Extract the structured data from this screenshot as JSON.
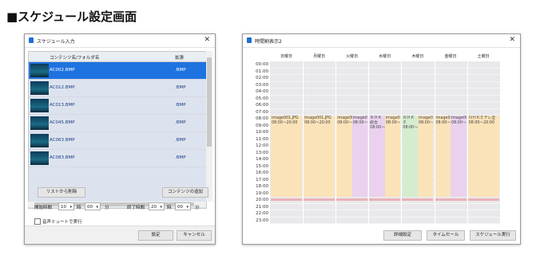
{
  "page": {
    "heading": "■スケジュール設定画面"
  },
  "input_window": {
    "title": "スケジュール入力",
    "columns": [
      "コンテンツ名/フォルダ名",
      "拡張"
    ],
    "rows": [
      {
        "name": "AC002.BMP",
        "ext": ".BMP"
      },
      {
        "name": "AC012.BMP",
        "ext": ".BMP"
      },
      {
        "name": "AC013.BMP",
        "ext": ".BMP"
      },
      {
        "name": "AC045.BMP",
        "ext": ".BMP"
      },
      {
        "name": "AC063.BMP",
        "ext": ".BMP"
      },
      {
        "name": "AC083.BMP",
        "ext": ".BMP"
      }
    ],
    "remove_label": "リストから削除",
    "add_label": "コンテンツの追加",
    "start_label": "開始時間",
    "start_hour": "10",
    "start_min": "00",
    "end_label": "終了時間",
    "end_hour": "20",
    "end_min": "00",
    "hour_unit": "時",
    "min_unit": "分",
    "mute_label": "音声ミュートで実行",
    "ok_label": "設定",
    "cancel_label": "キャンセル"
  },
  "calendar_window": {
    "title": "時間割表示2",
    "days": [
      "日曜日",
      "月曜日",
      "火曜日",
      "水曜日",
      "木曜日",
      "金曜日",
      "土曜日"
    ],
    "hours": [
      "00:00",
      "01:00",
      "02:00",
      "03:00",
      "04:00",
      "05:00",
      "06:00",
      "07:00",
      "08:00",
      "09:00",
      "10:00",
      "11:00",
      "12:00",
      "13:00",
      "14:00",
      "15:00",
      "16:00",
      "17:00",
      "18:00",
      "19:00",
      "20:00",
      "21:00",
      "22:00",
      "23:00"
    ],
    "blocks": [
      {
        "day": 0,
        "sub": 0,
        "color": "#fbe3b9",
        "text": "image001.JPG 08:00〜20:00"
      },
      {
        "day": 1,
        "sub": 0,
        "color": "#fbe3b9",
        "text": "image001.JPG 08:00〜20:00"
      },
      {
        "day": 2,
        "sub": 0,
        "color": "#fbe3b9",
        "text": "image00 08:00〜"
      },
      {
        "day": 2,
        "sub": 1,
        "color": "#ead2ee",
        "text": "image00 08:00〜"
      },
      {
        "day": 3,
        "sub": 0,
        "color": "#ead2ee",
        "text": "ＮＨＫ総合 08:00〜"
      },
      {
        "day": 3,
        "sub": 1,
        "color": "#fbe3b9",
        "text": "image00 08:00〜"
      },
      {
        "day": 4,
        "sub": 0,
        "color": "#d6ecd0",
        "text": "ＮＨＫＥ 08:00〜"
      },
      {
        "day": 4,
        "sub": 1,
        "color": "#fbe3b9",
        "text": "image00 08:00〜"
      },
      {
        "day": 5,
        "sub": 0,
        "color": "#fbe3b9",
        "text": "image00 08:00〜"
      },
      {
        "day": 5,
        "sub": 1,
        "color": "#ead2ee",
        "text": "image00 08:00〜"
      },
      {
        "day": 6,
        "sub": 0,
        "color": "#fbe3b9",
        "text": "ＮＨＫＥテレ全 08:00〜20:00"
      }
    ],
    "detail_label": "詳細設定",
    "timesale_label": "タイムセール",
    "run_label": "スケジュール実行"
  }
}
